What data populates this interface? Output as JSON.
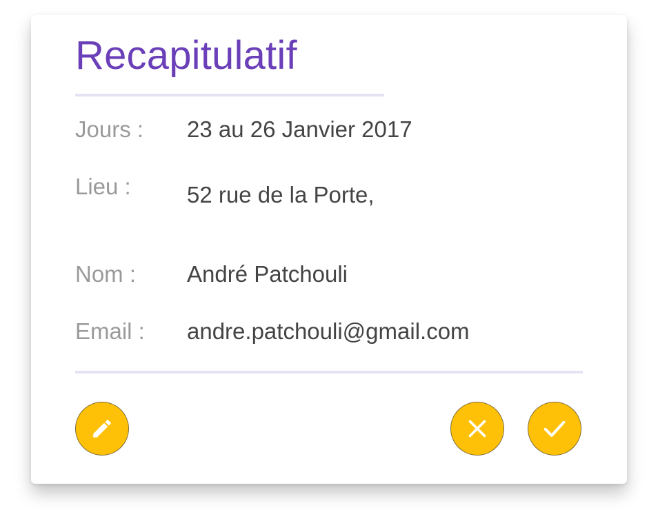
{
  "card": {
    "title": "Recapitulatif",
    "rows": [
      {
        "label": "Jours :",
        "value": "23 au 26 Janvier 2017"
      },
      {
        "label": "Lieu :",
        "value": "52 rue de la Porte,"
      },
      {
        "label": "Nom :",
        "value": "André Patchouli"
      },
      {
        "label": "Email :",
        "value": "andre.patchouli@gmail.com"
      }
    ]
  },
  "actions": {
    "edit_icon": "pencil-icon",
    "cancel_icon": "close-icon",
    "confirm_icon": "check-icon"
  },
  "colors": {
    "title": "#6a3fb8",
    "button": "#ffc107",
    "rule": "#e7e1f4",
    "label": "#9a9a9a",
    "value": "#444444"
  }
}
